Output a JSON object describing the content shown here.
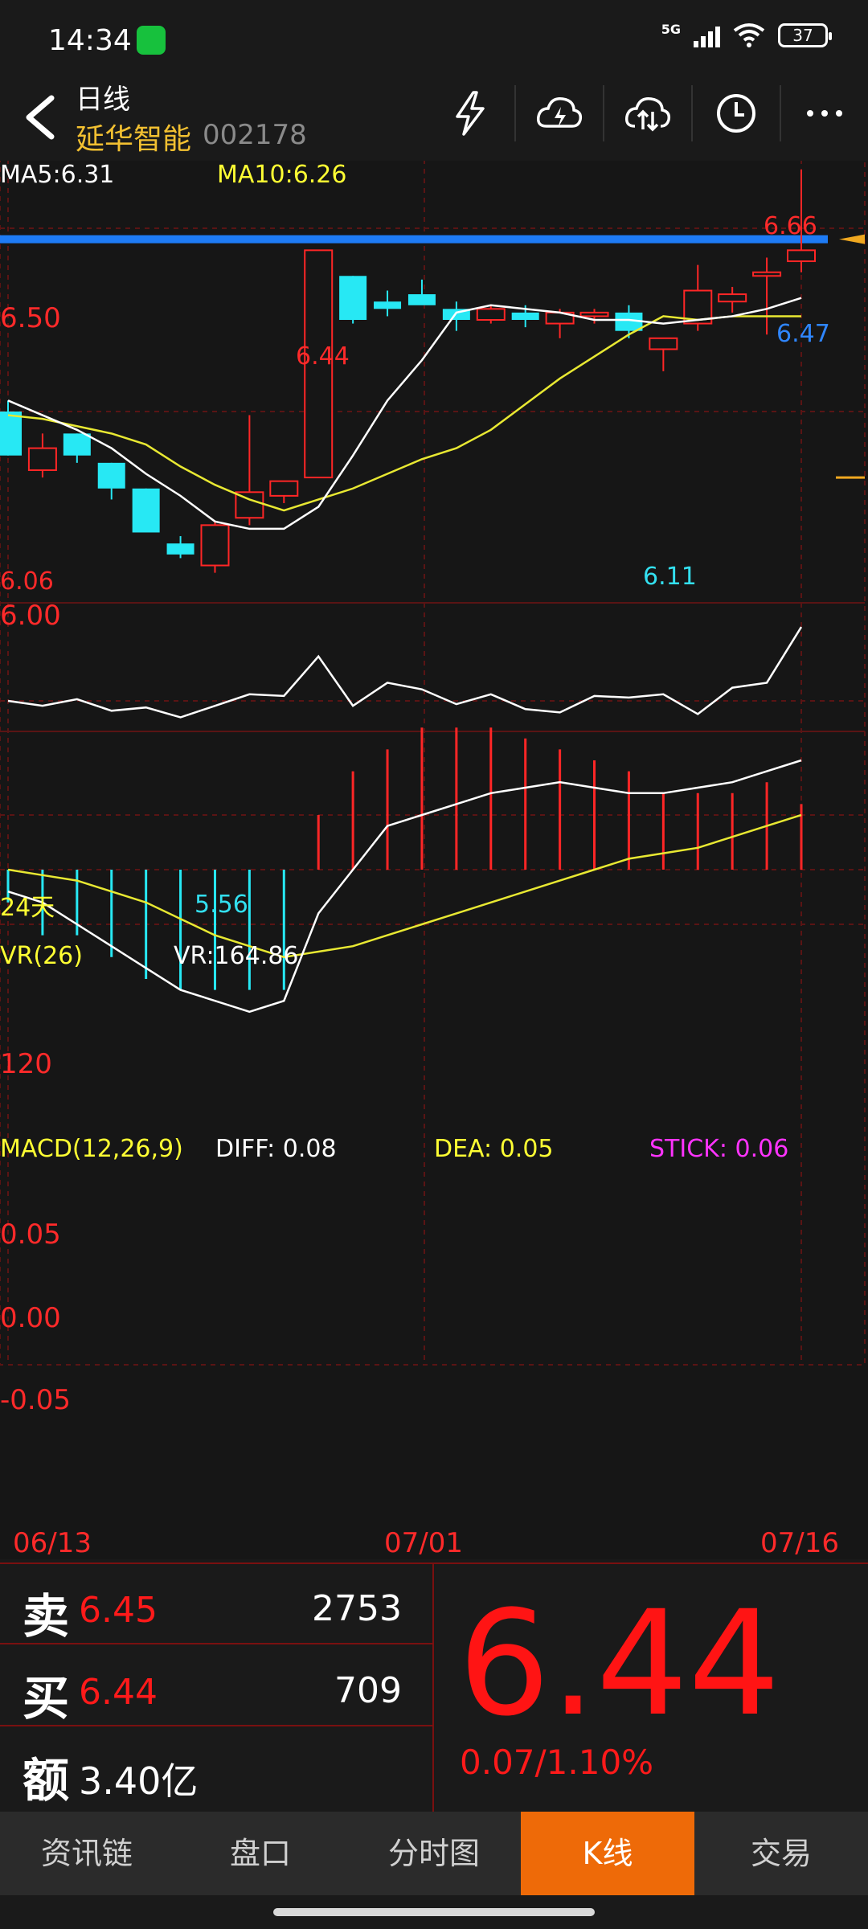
{
  "status_bar": {
    "time": "14:34",
    "network": "5G",
    "battery": "37"
  },
  "header": {
    "title": "日线",
    "stock_name": "延华智能",
    "stock_code": "002178"
  },
  "icons": {
    "flash": "flash-icon",
    "cloud_up": "cloud-lightning-icon",
    "cloud_sync": "cloud-sync-icon",
    "clock": "clock-icon",
    "more": "more-icon"
  },
  "chart_labels": {
    "ma5": "MA5:6.31",
    "ma10": "MA10:6.26",
    "price_666": "6.66",
    "price_650": "6.50",
    "price_647": "6.47",
    "price_644": "6.44",
    "price_606": "6.06",
    "price_600": "6.00",
    "price_611": "6.11",
    "price_556": "5.56",
    "period": "24天",
    "vr_title": "VR(26)",
    "vr_value": "VR:164.86",
    "vr_120": "120",
    "macd_title": "MACD(12,26,9)",
    "diff": "DIFF: 0.08",
    "dea": "DEA: 0.05",
    "stick": "STICK: 0.06",
    "macd_005": "0.05",
    "macd_000": "0.00",
    "macd_m005": "-0.05",
    "date_start": "06/13",
    "date_mid": "07/01",
    "date_end": "07/16"
  },
  "chart_data": {
    "type": "candlestick",
    "dates_visible": [
      "06/13",
      "07/01",
      "07/16"
    ],
    "candles": [
      {
        "o": 6.0,
        "h": 6.03,
        "l": 5.88,
        "c": 5.88
      },
      {
        "o": 5.84,
        "h": 5.94,
        "l": 5.82,
        "c": 5.9
      },
      {
        "o": 5.94,
        "h": 5.94,
        "l": 5.86,
        "c": 5.88
      },
      {
        "o": 5.86,
        "h": 5.86,
        "l": 5.76,
        "c": 5.79
      },
      {
        "o": 5.79,
        "h": 5.79,
        "l": 5.68,
        "c": 5.67
      },
      {
        "o": 5.64,
        "h": 5.66,
        "l": 5.6,
        "c": 5.61
      },
      {
        "o": 5.58,
        "h": 5.7,
        "l": 5.56,
        "c": 5.69
      },
      {
        "o": 5.71,
        "h": 5.99,
        "l": 5.69,
        "c": 5.78
      },
      {
        "o": 5.77,
        "h": 5.8,
        "l": 5.75,
        "c": 5.81
      },
      {
        "o": 5.82,
        "h": 6.44,
        "l": 5.82,
        "c": 6.44
      },
      {
        "o": 6.37,
        "h": 6.37,
        "l": 6.24,
        "c": 6.25
      },
      {
        "o": 6.3,
        "h": 6.33,
        "l": 6.26,
        "c": 6.28
      },
      {
        "o": 6.32,
        "h": 6.36,
        "l": 6.3,
        "c": 6.29
      },
      {
        "o": 6.28,
        "h": 6.3,
        "l": 6.22,
        "c": 6.25
      },
      {
        "o": 6.25,
        "h": 6.29,
        "l": 6.24,
        "c": 6.28
      },
      {
        "o": 6.27,
        "h": 6.29,
        "l": 6.23,
        "c": 6.25
      },
      {
        "o": 6.24,
        "h": 6.28,
        "l": 6.2,
        "c": 6.27
      },
      {
        "o": 6.26,
        "h": 6.28,
        "l": 6.24,
        "c": 6.27
      },
      {
        "o": 6.27,
        "h": 6.29,
        "l": 6.2,
        "c": 6.22
      },
      {
        "o": 6.17,
        "h": 6.2,
        "l": 6.11,
        "c": 6.2
      },
      {
        "o": 6.24,
        "h": 6.4,
        "l": 6.22,
        "c": 6.33
      },
      {
        "o": 6.3,
        "h": 6.34,
        "l": 6.27,
        "c": 6.32
      },
      {
        "o": 6.37,
        "h": 6.42,
        "l": 6.21,
        "c": 6.38
      },
      {
        "o": 6.41,
        "h": 6.66,
        "l": 6.38,
        "c": 6.44
      }
    ],
    "ma5": [
      6.03,
      5.99,
      5.95,
      5.9,
      5.83,
      5.77,
      5.7,
      5.68,
      5.68,
      5.74,
      5.88,
      6.03,
      6.14,
      6.27,
      6.29,
      6.28,
      6.27,
      6.25,
      6.25,
      6.24,
      6.25,
      6.26,
      6.28,
      6.31
    ],
    "ma10": [
      5.99,
      5.98,
      5.96,
      5.94,
      5.91,
      5.85,
      5.8,
      5.76,
      5.73,
      5.76,
      5.79,
      5.83,
      5.87,
      5.9,
      5.95,
      6.02,
      6.09,
      6.15,
      6.21,
      6.26,
      6.25,
      6.26,
      6.26,
      6.26
    ],
    "vr": [
      120,
      117,
      121,
      114,
      116,
      110,
      117,
      124,
      123,
      147,
      117,
      131,
      127,
      118,
      124,
      115,
      113,
      123,
      122,
      124,
      112,
      128,
      131,
      164.86
    ],
    "macd_diff": [
      -0.02,
      -0.03,
      -0.05,
      -0.07,
      -0.09,
      -0.11,
      -0.12,
      -0.13,
      -0.12,
      -0.04,
      0.0,
      0.04,
      0.05,
      0.06,
      0.07,
      0.075,
      0.08,
      0.075,
      0.07,
      0.07,
      0.075,
      0.08,
      0.09,
      0.1
    ],
    "macd_dea": [
      0.0,
      -0.005,
      -0.01,
      -0.02,
      -0.03,
      -0.045,
      -0.06,
      -0.07,
      -0.08,
      -0.075,
      -0.07,
      -0.06,
      -0.05,
      -0.04,
      -0.03,
      -0.02,
      -0.01,
      0.0,
      0.01,
      0.015,
      0.02,
      0.03,
      0.04,
      0.05
    ],
    "macd_stick": [
      -0.03,
      -0.06,
      -0.06,
      -0.08,
      -0.1,
      -0.11,
      -0.11,
      -0.11,
      -0.11,
      0.05,
      0.09,
      0.11,
      0.13,
      0.13,
      0.13,
      0.12,
      0.11,
      0.1,
      0.09,
      0.07,
      0.07,
      0.07,
      0.08,
      0.06
    ],
    "price_ylim": [
      5.5,
      6.72
    ],
    "horizontal_line": 6.47
  },
  "quote": {
    "sell_char": "卖",
    "sell_price": "6.45",
    "sell_volume": "2753",
    "buy_char": "买",
    "buy_price": "6.44",
    "buy_volume": "709",
    "amount_char": "额",
    "amount": "3.40亿",
    "last_price": "6.44",
    "change": "0.07/1.10%"
  },
  "tabs": [
    {
      "label": "资讯链"
    },
    {
      "label": "盘口"
    },
    {
      "label": "分时图"
    },
    {
      "label": "K线"
    },
    {
      "label": "交易"
    }
  ]
}
